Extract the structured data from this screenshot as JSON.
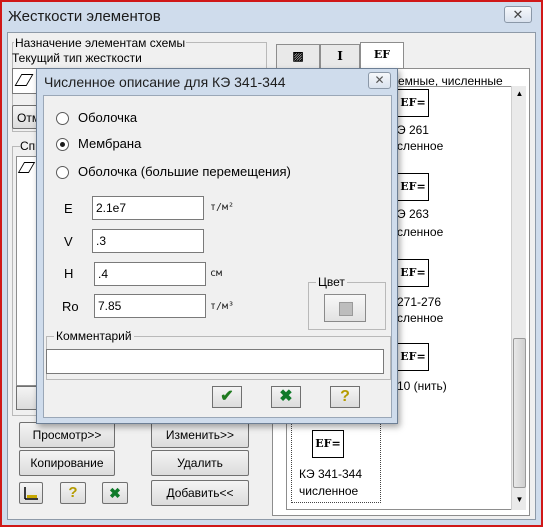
{
  "main_window": {
    "title": "Жесткости элементов",
    "close_glyph": "✕",
    "assignment_group": "Назначение элементам схемы",
    "current_type_label": "Текущий тип жесткости",
    "left_button_partial": "Отм",
    "list_group_partial": "Спи",
    "view_button": "Просмотр>>",
    "copy_button": "Копирование",
    "change_button": "Изменить>>",
    "delete_button": "Удалить",
    "add_button": "Добавить<<",
    "tabs": [
      "▨",
      "I",
      "EF"
    ],
    "right_header": "емные, численные",
    "right_items": [
      {
        "icon_text": "EF=",
        "line1": "Э 261",
        "line2": "сленное"
      },
      {
        "icon_text": "EF=",
        "line1": "Э 263",
        "line2": "сленное"
      },
      {
        "icon_text": "EF=",
        "line1": "271-276",
        "line2": "сленное"
      },
      {
        "icon_text": "EF=",
        "line1": "10 (нить)",
        "line2": ""
      },
      {
        "icon_text": "EF=",
        "line1": "КЭ 341-344",
        "line2": "численное"
      }
    ]
  },
  "dialog": {
    "title": "Численное описание для КЭ 341-344",
    "close_glyph": "✕",
    "radio_options": [
      {
        "label": "Оболочка",
        "selected": false
      },
      {
        "label": "Мембрана",
        "selected": true
      },
      {
        "label": "Оболочка (большие перемещения)",
        "selected": false
      }
    ],
    "params": [
      {
        "label": "E",
        "value": "2.1e7",
        "unit": "т/м²"
      },
      {
        "label": "V",
        "value": ".3",
        "unit": ""
      },
      {
        "label": "H",
        "value": ".4",
        "unit": "см"
      },
      {
        "label": "Ro",
        "value": "7.85",
        "unit": "т/м³"
      }
    ],
    "color_group": "Цвет",
    "comment_group": "Комментарий",
    "comment_value": "",
    "ok_glyph": "✔",
    "cancel_glyph": "✖",
    "help_glyph": "?"
  },
  "colors": {
    "ok": "#1f7a1f",
    "cancel": "#0f7a2a",
    "help": "#b59b00",
    "frame": "#d01818"
  }
}
